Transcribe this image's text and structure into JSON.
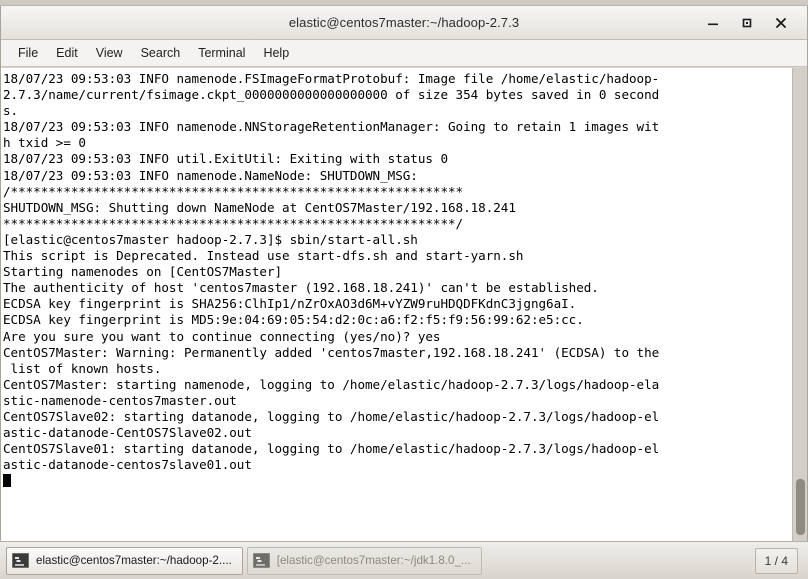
{
  "window": {
    "title": "elastic@centos7master:~/hadoop-2.7.3",
    "buttons": {
      "minimize": "minimize-button",
      "maximize": "maximize-button",
      "close": "close-button"
    }
  },
  "menubar": {
    "items": [
      {
        "label": "File"
      },
      {
        "label": "Edit"
      },
      {
        "label": "View"
      },
      {
        "label": "Search"
      },
      {
        "label": "Terminal"
      },
      {
        "label": "Help"
      }
    ]
  },
  "terminal": {
    "lines": [
      "18/07/23 09:53:03 INFO namenode.FSImageFormatProtobuf: Image file /home/elastic/hadoop-",
      "2.7.3/name/current/fsimage.ckpt_0000000000000000000 of size 354 bytes saved in 0 second",
      "s.",
      "18/07/23 09:53:03 INFO namenode.NNStorageRetentionManager: Going to retain 1 images wit",
      "h txid >= 0",
      "18/07/23 09:53:03 INFO util.ExitUtil: Exiting with status 0",
      "18/07/23 09:53:03 INFO namenode.NameNode: SHUTDOWN_MSG:",
      "/************************************************************",
      "SHUTDOWN_MSG: Shutting down NameNode at CentOS7Master/192.168.18.241",
      "************************************************************/",
      "[elastic@centos7master hadoop-2.7.3]$ sbin/start-all.sh",
      "This script is Deprecated. Instead use start-dfs.sh and start-yarn.sh",
      "Starting namenodes on [CentOS7Master]",
      "The authenticity of host 'centos7master (192.168.18.241)' can't be established.",
      "ECDSA key fingerprint is SHA256:ClhIp1/nZrOxAO3d6M+vYZW9ruHDQDFKdnC3jgng6aI.",
      "ECDSA key fingerprint is MD5:9e:04:69:05:54:d2:0c:a6:f2:f5:f9:56:99:62:e5:cc.",
      "Are you sure you want to continue connecting (yes/no)? yes",
      "CentOS7Master: Warning: Permanently added 'centos7master,192.168.18.241' (ECDSA) to the",
      " list of known hosts.",
      "CentOS7Master: starting namenode, logging to /home/elastic/hadoop-2.7.3/logs/hadoop-ela",
      "stic-namenode-centos7master.out",
      "CentOS7Slave02: starting datanode, logging to /home/elastic/hadoop-2.7.3/logs/hadoop-el",
      "astic-datanode-CentOS7Slave02.out",
      "CentOS7Slave01: starting datanode, logging to /home/elastic/hadoop-2.7.3/logs/hadoop-el",
      "astic-datanode-centos7slave01.out"
    ],
    "cursor": "block-cursor"
  },
  "taskbar": {
    "tasks": [
      {
        "label": "elastic@centos7master:~/hadoop-2....",
        "state": "active"
      },
      {
        "label": "[elastic@centos7master:~/jdk1.8.0_...",
        "state": "inactive"
      }
    ],
    "pager": "1 / 4"
  }
}
